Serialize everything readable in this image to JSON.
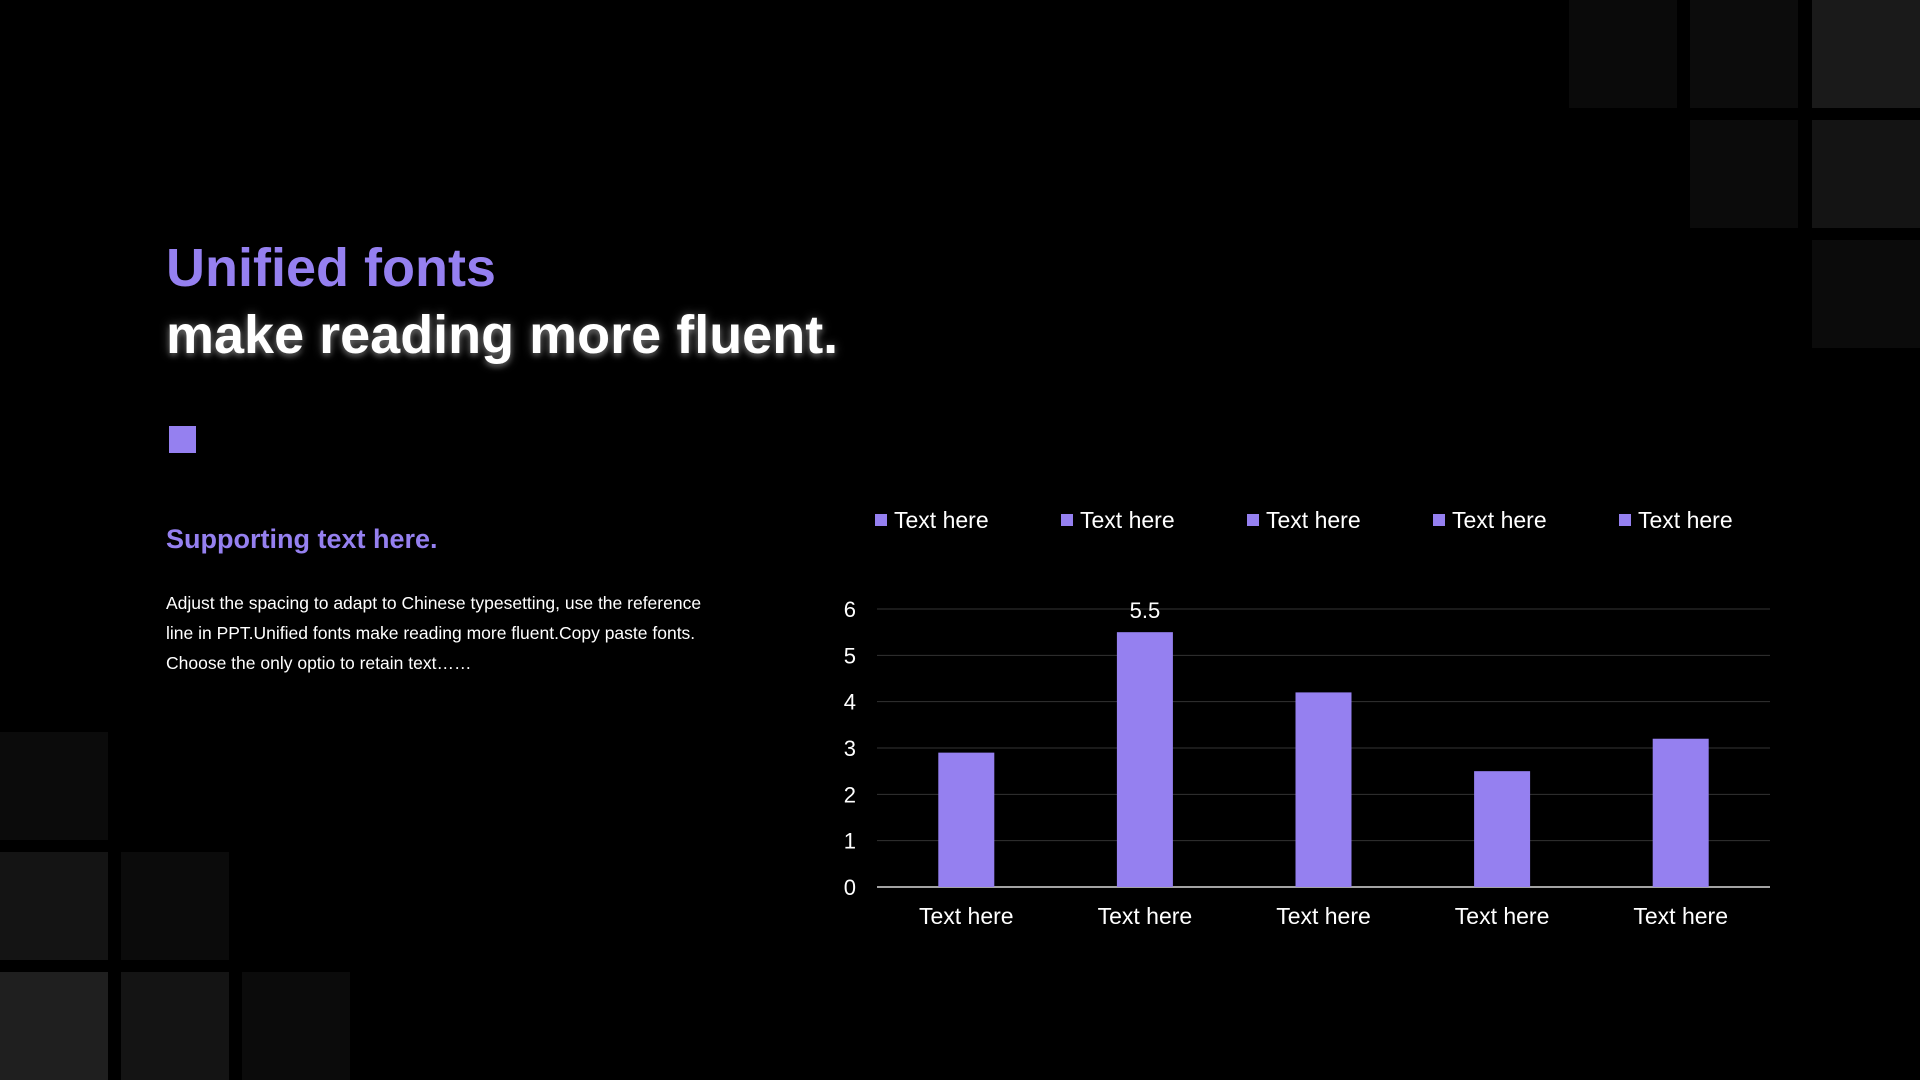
{
  "colors": {
    "background": "#000000",
    "accent": "#9580f0",
    "text": "#ffffff",
    "gridline": "#333333",
    "axis": "#d9d9d9"
  },
  "title": {
    "line1": "Unified fonts",
    "line2": "make reading more fluent."
  },
  "support": {
    "heading": "Supporting text here.",
    "body": "Adjust the spacing to adapt to Chinese typesetting, use the reference line in PPT.Unified fonts make reading more fluent.Copy paste fonts. Choose the only optio to retain text……"
  },
  "chart_data": {
    "type": "bar",
    "categories": [
      "Text here",
      "Text here",
      "Text here",
      "Text here",
      "Text here"
    ],
    "values": [
      2.9,
      5.5,
      4.2,
      2.5,
      3.2
    ],
    "data_labels": [
      null,
      "5.5",
      null,
      null,
      null
    ],
    "legend": [
      "Text here",
      "Text here",
      "Text here",
      "Text here",
      "Text here"
    ],
    "legend_position": "top",
    "yticks": [
      "0",
      "1",
      "2",
      "3",
      "4",
      "5",
      "6"
    ],
    "ylim": [
      0,
      6
    ],
    "grid": true,
    "title": "",
    "xlabel": "",
    "ylabel": ""
  }
}
